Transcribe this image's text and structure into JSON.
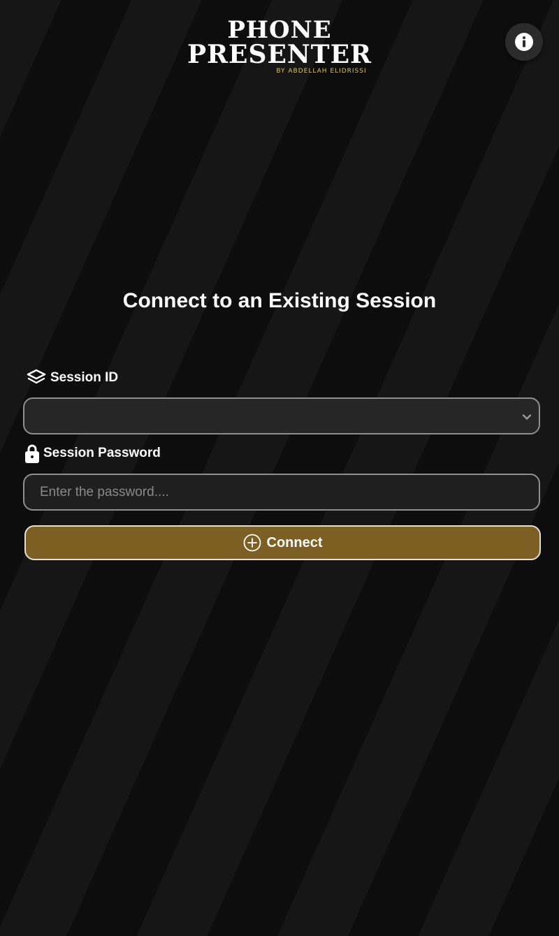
{
  "logo": {
    "line1": "PHONE",
    "line2": "PRESENTER",
    "byline": "BY ABDELLAH ELIDRISSI"
  },
  "info_button": {
    "icon": "info-icon"
  },
  "heading": "Connect to an Existing Session",
  "session_id": {
    "label": "Session ID",
    "icon": "layers-icon",
    "selected_value": ""
  },
  "session_password": {
    "label": "Session Password",
    "icon": "lock-icon",
    "value": "",
    "placeholder": "Enter the password...."
  },
  "connect_button": {
    "label": "Connect",
    "icon": "plus-circle-icon"
  },
  "colors": {
    "accent": "#7c5f22",
    "byline": "#e0c24a",
    "background": "#0e0e0e"
  }
}
